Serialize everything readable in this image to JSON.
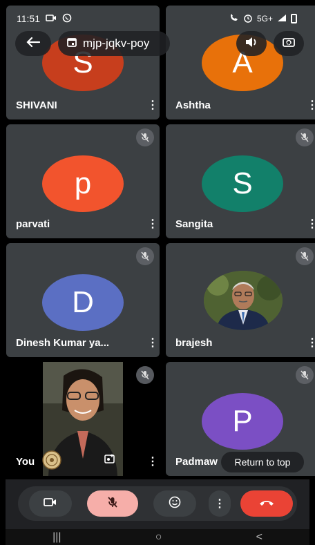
{
  "status": {
    "time": "11:51",
    "network": "5G+"
  },
  "topbar": {
    "meeting_code": "mjp-jqkv-poy"
  },
  "participants": [
    {
      "name": "SHIVANI",
      "initial": "S",
      "color": "#c73e1d"
    },
    {
      "name": "Ashtha",
      "initial": "A",
      "color": "#e8710a"
    },
    {
      "name": "parvati",
      "initial": "p",
      "color": "#f2542d"
    },
    {
      "name": "Sangita",
      "initial": "S",
      "color": "#12806a"
    },
    {
      "name": "Dinesh Kumar ya...",
      "initial": "D",
      "color": "#5b6fc3"
    },
    {
      "name": "brajesh",
      "initial": "",
      "color": "#5b6b3a"
    },
    {
      "name": "You",
      "initial": "",
      "color": "#2e3128"
    },
    {
      "name": "Padmaw",
      "initial": "P",
      "color": "#7b4fc4"
    }
  ],
  "overlay": {
    "return_to_top": "Return to top"
  },
  "controls": {
    "camera_icon": "videocam-icon",
    "mic_icon": "mic-off-icon",
    "emoji_icon": "emoji-icon",
    "more_icon": "more-vert-icon",
    "hangup_icon": "call-end-icon"
  },
  "nav": {
    "recents": "|||",
    "home": "○",
    "back": "<"
  }
}
